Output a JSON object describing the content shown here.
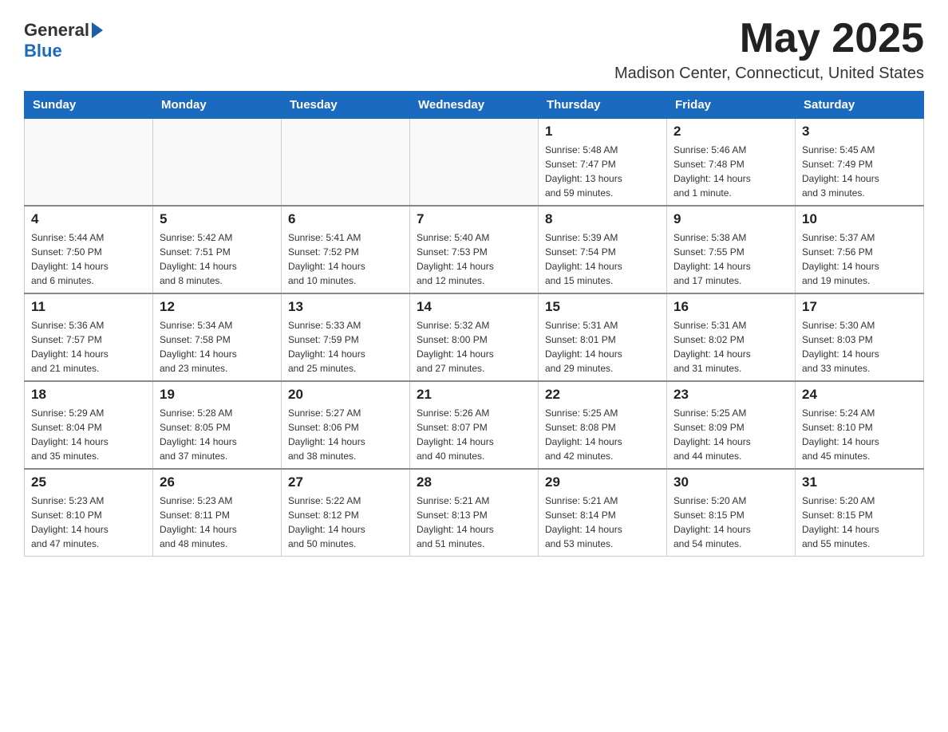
{
  "header": {
    "logo_general": "General",
    "logo_blue": "Blue",
    "month_year": "May 2025",
    "location": "Madison Center, Connecticut, United States"
  },
  "days_of_week": [
    "Sunday",
    "Monday",
    "Tuesday",
    "Wednesday",
    "Thursday",
    "Friday",
    "Saturday"
  ],
  "weeks": [
    [
      {
        "day": "",
        "info": ""
      },
      {
        "day": "",
        "info": ""
      },
      {
        "day": "",
        "info": ""
      },
      {
        "day": "",
        "info": ""
      },
      {
        "day": "1",
        "info": "Sunrise: 5:48 AM\nSunset: 7:47 PM\nDaylight: 13 hours\nand 59 minutes."
      },
      {
        "day": "2",
        "info": "Sunrise: 5:46 AM\nSunset: 7:48 PM\nDaylight: 14 hours\nand 1 minute."
      },
      {
        "day": "3",
        "info": "Sunrise: 5:45 AM\nSunset: 7:49 PM\nDaylight: 14 hours\nand 3 minutes."
      }
    ],
    [
      {
        "day": "4",
        "info": "Sunrise: 5:44 AM\nSunset: 7:50 PM\nDaylight: 14 hours\nand 6 minutes."
      },
      {
        "day": "5",
        "info": "Sunrise: 5:42 AM\nSunset: 7:51 PM\nDaylight: 14 hours\nand 8 minutes."
      },
      {
        "day": "6",
        "info": "Sunrise: 5:41 AM\nSunset: 7:52 PM\nDaylight: 14 hours\nand 10 minutes."
      },
      {
        "day": "7",
        "info": "Sunrise: 5:40 AM\nSunset: 7:53 PM\nDaylight: 14 hours\nand 12 minutes."
      },
      {
        "day": "8",
        "info": "Sunrise: 5:39 AM\nSunset: 7:54 PM\nDaylight: 14 hours\nand 15 minutes."
      },
      {
        "day": "9",
        "info": "Sunrise: 5:38 AM\nSunset: 7:55 PM\nDaylight: 14 hours\nand 17 minutes."
      },
      {
        "day": "10",
        "info": "Sunrise: 5:37 AM\nSunset: 7:56 PM\nDaylight: 14 hours\nand 19 minutes."
      }
    ],
    [
      {
        "day": "11",
        "info": "Sunrise: 5:36 AM\nSunset: 7:57 PM\nDaylight: 14 hours\nand 21 minutes."
      },
      {
        "day": "12",
        "info": "Sunrise: 5:34 AM\nSunset: 7:58 PM\nDaylight: 14 hours\nand 23 minutes."
      },
      {
        "day": "13",
        "info": "Sunrise: 5:33 AM\nSunset: 7:59 PM\nDaylight: 14 hours\nand 25 minutes."
      },
      {
        "day": "14",
        "info": "Sunrise: 5:32 AM\nSunset: 8:00 PM\nDaylight: 14 hours\nand 27 minutes."
      },
      {
        "day": "15",
        "info": "Sunrise: 5:31 AM\nSunset: 8:01 PM\nDaylight: 14 hours\nand 29 minutes."
      },
      {
        "day": "16",
        "info": "Sunrise: 5:31 AM\nSunset: 8:02 PM\nDaylight: 14 hours\nand 31 minutes."
      },
      {
        "day": "17",
        "info": "Sunrise: 5:30 AM\nSunset: 8:03 PM\nDaylight: 14 hours\nand 33 minutes."
      }
    ],
    [
      {
        "day": "18",
        "info": "Sunrise: 5:29 AM\nSunset: 8:04 PM\nDaylight: 14 hours\nand 35 minutes."
      },
      {
        "day": "19",
        "info": "Sunrise: 5:28 AM\nSunset: 8:05 PM\nDaylight: 14 hours\nand 37 minutes."
      },
      {
        "day": "20",
        "info": "Sunrise: 5:27 AM\nSunset: 8:06 PM\nDaylight: 14 hours\nand 38 minutes."
      },
      {
        "day": "21",
        "info": "Sunrise: 5:26 AM\nSunset: 8:07 PM\nDaylight: 14 hours\nand 40 minutes."
      },
      {
        "day": "22",
        "info": "Sunrise: 5:25 AM\nSunset: 8:08 PM\nDaylight: 14 hours\nand 42 minutes."
      },
      {
        "day": "23",
        "info": "Sunrise: 5:25 AM\nSunset: 8:09 PM\nDaylight: 14 hours\nand 44 minutes."
      },
      {
        "day": "24",
        "info": "Sunrise: 5:24 AM\nSunset: 8:10 PM\nDaylight: 14 hours\nand 45 minutes."
      }
    ],
    [
      {
        "day": "25",
        "info": "Sunrise: 5:23 AM\nSunset: 8:10 PM\nDaylight: 14 hours\nand 47 minutes."
      },
      {
        "day": "26",
        "info": "Sunrise: 5:23 AM\nSunset: 8:11 PM\nDaylight: 14 hours\nand 48 minutes."
      },
      {
        "day": "27",
        "info": "Sunrise: 5:22 AM\nSunset: 8:12 PM\nDaylight: 14 hours\nand 50 minutes."
      },
      {
        "day": "28",
        "info": "Sunrise: 5:21 AM\nSunset: 8:13 PM\nDaylight: 14 hours\nand 51 minutes."
      },
      {
        "day": "29",
        "info": "Sunrise: 5:21 AM\nSunset: 8:14 PM\nDaylight: 14 hours\nand 53 minutes."
      },
      {
        "day": "30",
        "info": "Sunrise: 5:20 AM\nSunset: 8:15 PM\nDaylight: 14 hours\nand 54 minutes."
      },
      {
        "day": "31",
        "info": "Sunrise: 5:20 AM\nSunset: 8:15 PM\nDaylight: 14 hours\nand 55 minutes."
      }
    ]
  ]
}
